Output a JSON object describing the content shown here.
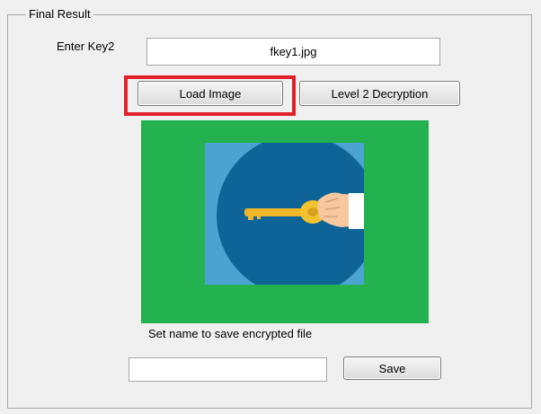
{
  "panel": {
    "title": "Final Result"
  },
  "key": {
    "label": "Enter Key2",
    "value": "fkey1.jpg"
  },
  "buttons": {
    "load_image": "Load Image",
    "level2_decryption": "Level 2 Decryption",
    "save": "Save"
  },
  "preview": {
    "image": "key-in-hand-image",
    "background_color": "#23b24f"
  },
  "save_section": {
    "caption": "Set name to save encrypted file",
    "filename_value": ""
  },
  "highlight_color": "#e0212a"
}
